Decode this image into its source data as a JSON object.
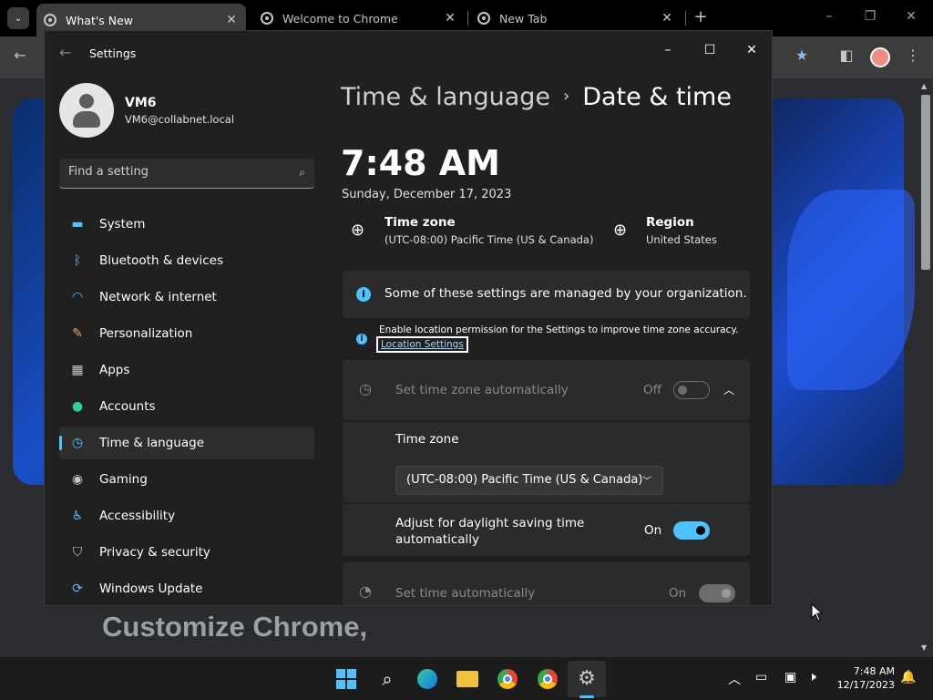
{
  "browser": {
    "tabs": [
      {
        "label": "What's New",
        "active": true
      },
      {
        "label": "Welcome to Chrome",
        "active": false
      },
      {
        "label": "New Tab",
        "active": false
      }
    ],
    "page_text": "Customize Chrome,"
  },
  "settings": {
    "window_title": "Settings",
    "user": {
      "name": "VM6",
      "email": "VM6@collabnet.local"
    },
    "search_placeholder": "Find a setting",
    "nav": [
      {
        "label": "System",
        "icon": "monitor-icon",
        "color": "#4cc2ff"
      },
      {
        "label": "Bluetooth & devices",
        "icon": "bluetooth-icon",
        "color": "#4cc2ff"
      },
      {
        "label": "Network & internet",
        "icon": "wifi-icon",
        "color": "#4cc2ff"
      },
      {
        "label": "Personalization",
        "icon": "brush-icon",
        "color": "#e8a86a"
      },
      {
        "label": "Apps",
        "icon": "apps-icon",
        "color": "#c8c8c8"
      },
      {
        "label": "Accounts",
        "icon": "person-icon",
        "color": "#2fd0a0"
      },
      {
        "label": "Time & language",
        "icon": "globe-clock-icon",
        "color": "#4cc2ff",
        "selected": true
      },
      {
        "label": "Gaming",
        "icon": "gamepad-icon",
        "color": "#c8c8c8"
      },
      {
        "label": "Accessibility",
        "icon": "accessibility-icon",
        "color": "#4cc2ff"
      },
      {
        "label": "Privacy & security",
        "icon": "shield-icon",
        "color": "#c8c8c8"
      },
      {
        "label": "Windows Update",
        "icon": "update-icon",
        "color": "#4cc2ff"
      }
    ],
    "breadcrumb": {
      "parent": "Time & language",
      "current": "Date & time"
    },
    "time": "7:48 AM",
    "date": "Sunday, December 17, 2023",
    "time_zone": {
      "label": "Time zone",
      "value": "(UTC-08:00) Pacific Time (US & Canada)"
    },
    "region": {
      "label": "Region",
      "value": "United States"
    },
    "managed_notice": "Some of these settings are managed by your organization.",
    "location_note": "Enable location permission for the Settings to improve time zone accuracy.",
    "location_link": "Location Settings",
    "set_tz_auto": {
      "label": "Set time zone automatically",
      "state": "Off"
    },
    "tz_dropdown": {
      "label": "Time zone",
      "value": "(UTC-08:00) Pacific Time (US & Canada)"
    },
    "dst": {
      "label_line1": "Adjust for daylight saving time",
      "label_line2": "automatically",
      "state": "On"
    },
    "set_time_auto": {
      "label": "Set time automatically",
      "state": "On"
    }
  },
  "taskbar": {
    "time": "7:48 AM",
    "date": "12/17/2023",
    "apps": [
      "start-icon",
      "search-icon",
      "edge-icon",
      "file-explorer-icon",
      "chrome-icon",
      "chrome-icon",
      "settings-icon"
    ]
  },
  "colors": {
    "accent": "#4cc2ff",
    "settings_bg": "#202020",
    "card_bg": "#2b2b2b"
  }
}
